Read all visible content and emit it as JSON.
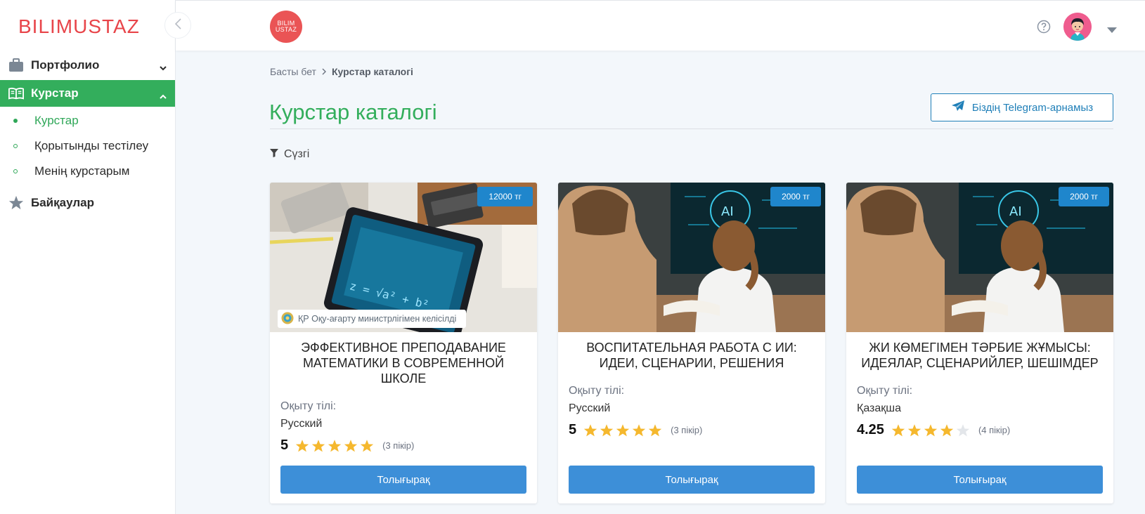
{
  "sidebar": {
    "logo": "BILIMUSTAZ",
    "items": [
      {
        "label": "Портфолио"
      },
      {
        "label": "Курстар"
      },
      {
        "label": "Байқаулар"
      }
    ],
    "subitems": [
      {
        "label": "Курстар"
      },
      {
        "label": "Қорытынды тестілеу"
      },
      {
        "label": "Менің курстарым"
      }
    ]
  },
  "topbar": {
    "brand_line1": "BILIM",
    "brand_line2": "USTAZ"
  },
  "breadcrumb": {
    "home": "Басты бет",
    "current": "Курстар каталогі"
  },
  "page": {
    "title": "Курстар каталогі",
    "telegram_button": "Біздің Telegram-арнамыз",
    "filter_label": "Сүзгі"
  },
  "cards": [
    {
      "price": "12000 тг",
      "badge": "ҚР Оқу-ағарту министрлігімен келісілді",
      "title": "Эффективное преподавание математики в современной школе",
      "lang_label": "Оқыту тілі:",
      "lang": "Русский",
      "score": "5",
      "rating": 5,
      "reviews": "(3 пікір)",
      "button": "Толығырақ"
    },
    {
      "price": "2000 тг",
      "title": "Воспитательная работа с ИИ: идеи, сценарии, решения",
      "lang_label": "Оқыту тілі:",
      "lang": "Русский",
      "score": "5",
      "rating": 5,
      "reviews": "(3 пікір)",
      "button": "Толығырақ"
    },
    {
      "price": "2000 тг",
      "title": "ЖИ көмегімен тәрбие жұмысы: идеялар, сценарийлер, шешімдер",
      "lang_label": "Оқыту тілі:",
      "lang": "Қазақша",
      "score": "4.25",
      "rating": 4,
      "reviews": "(4 пікір)",
      "button": "Толығырақ"
    }
  ],
  "colors": {
    "accent_green": "#33ae5c",
    "brand_red": "#e8454a",
    "primary_blue": "#3d8fd8",
    "star_gold": "#f5b82e"
  }
}
